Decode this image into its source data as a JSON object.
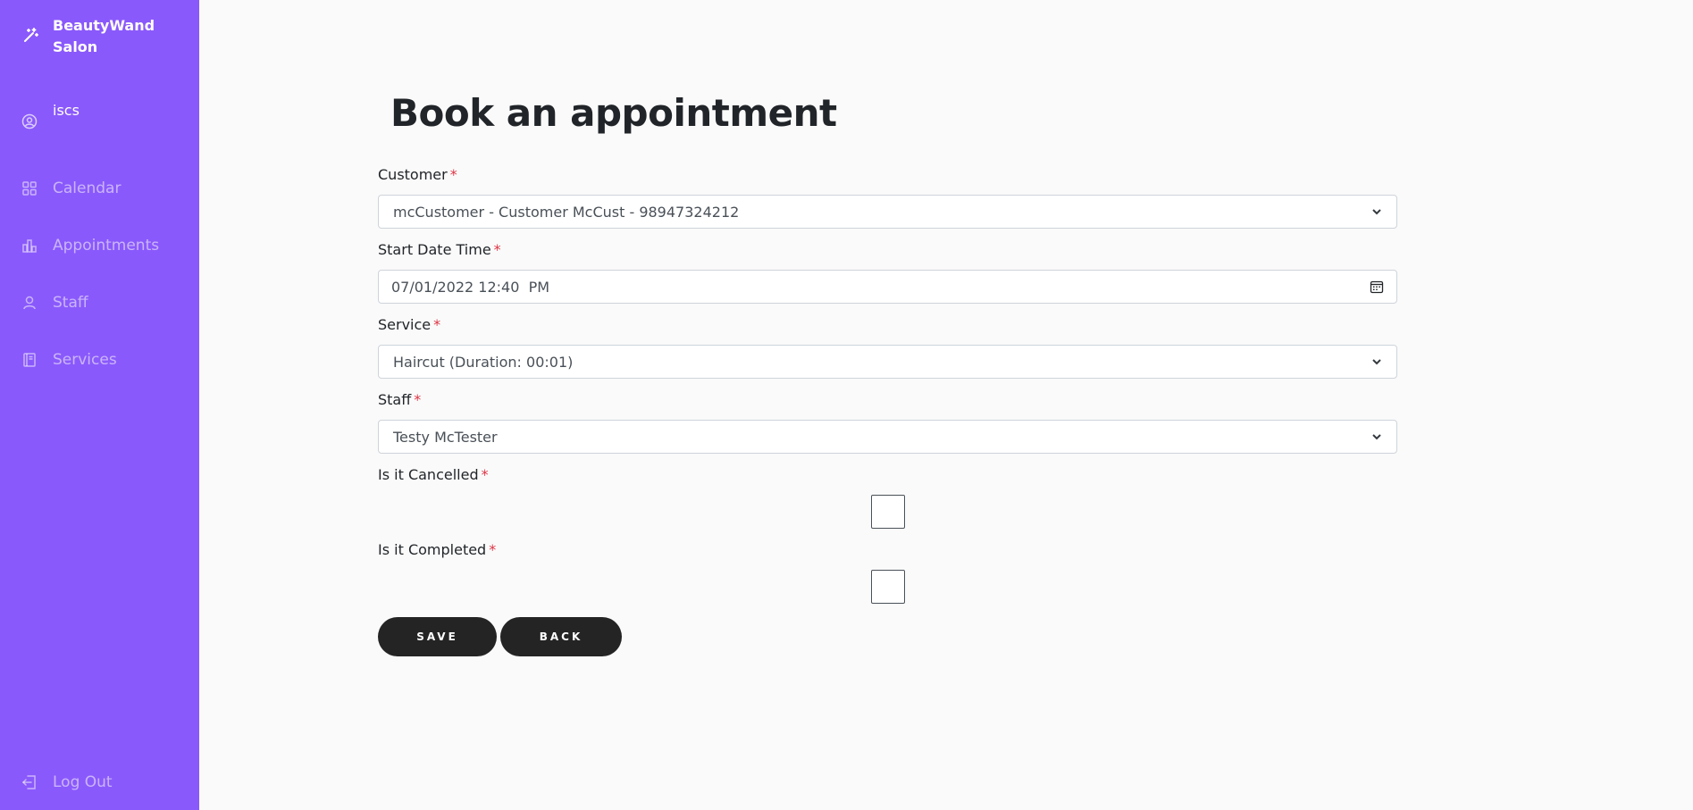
{
  "brand": {
    "name": "BeautyWand Salon"
  },
  "user": {
    "name": "iscs"
  },
  "nav": {
    "calendar": "Calendar",
    "appointments": "Appointments",
    "staff": "Staff",
    "services": "Services",
    "logout": "Log Out"
  },
  "page": {
    "title": "Book an appointment"
  },
  "form": {
    "customer": {
      "label": "Customer",
      "value": "mcCustomer - Customer McCust - 98947324212"
    },
    "start": {
      "label": "Start Date Time",
      "value": "07/01/2022 12:40  PM"
    },
    "service": {
      "label": "Service",
      "value": "Haircut (Duration: 00:01)"
    },
    "staff": {
      "label": "Staff",
      "value": "Testy McTester"
    },
    "cancelled": {
      "label": "Is it Cancelled"
    },
    "completed": {
      "label": "Is it Completed"
    },
    "required_mark": "*",
    "save_label": "SAVE",
    "back_label": "BACK"
  },
  "colors": {
    "sidebar": "#8a59fb",
    "button": "#242424",
    "required": "#dc3545"
  },
  "icons": {
    "brand": "magic-wand-icon",
    "user": "user-circle-icon",
    "calendar": "grid-icon",
    "appointments": "bar-chart-icon",
    "staff": "person-icon",
    "services": "book-icon",
    "logout": "logout-icon",
    "dropdown": "chevron-down-icon",
    "date": "calendar-icon"
  }
}
